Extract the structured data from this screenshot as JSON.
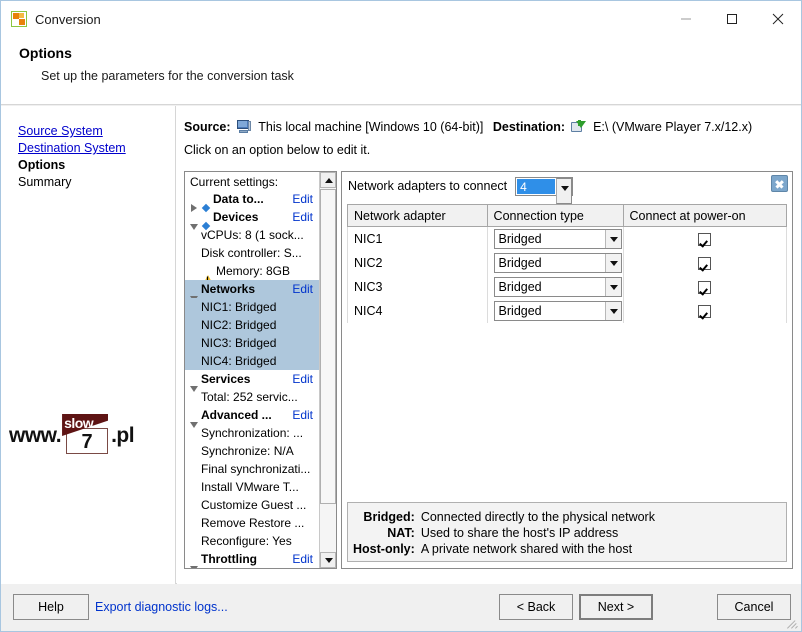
{
  "window": {
    "title": "Conversion",
    "icon": "conversion-app-icon",
    "controls": {
      "minimize": "minimize-icon",
      "maximize": "maximize-icon",
      "close": "close-icon"
    }
  },
  "page_header": {
    "heading": "Options",
    "subheading": "Set up the parameters for the conversion task"
  },
  "left_nav": {
    "items": [
      {
        "label": "Source System",
        "state": "link"
      },
      {
        "label": "Destination System",
        "state": "link"
      },
      {
        "label": "Options",
        "state": "current"
      },
      {
        "label": "Summary",
        "state": "plain"
      }
    ]
  },
  "watermark": {
    "prefix": "www.",
    "banner": "slow",
    "number": "7",
    "suffix": ".pl"
  },
  "source_dest": {
    "source_label": "Source:",
    "source_icon": "local-machine-icon",
    "source_value": "This local machine [Windows 10 (64-bit)]",
    "destination_label": "Destination:",
    "destination_icon": "destination-disk-icon",
    "destination_value": "E:\\ (VMware Player 7.x/12.x)",
    "hint": "Click on an option below to edit it."
  },
  "settings_tree": {
    "caption": "Current settings:",
    "edit_label": "Edit",
    "rows": [
      {
        "label": "Data to...",
        "marker": "triangle-right",
        "bullet": "diamond",
        "bold": true,
        "edit": true,
        "selected": false,
        "indent": 0
      },
      {
        "label": "Devices",
        "marker": "triangle-down",
        "bullet": "diamond",
        "bold": true,
        "edit": true,
        "selected": false,
        "indent": 0
      },
      {
        "label": "vCPUs: 8 (1 sock...",
        "marker": "none",
        "bullet": "none",
        "bold": false,
        "edit": false,
        "selected": false,
        "indent": 1
      },
      {
        "label": "Disk controller: S...",
        "marker": "none",
        "bullet": "none",
        "bold": false,
        "edit": false,
        "selected": false,
        "indent": 1
      },
      {
        "label": "Memory: 8GB",
        "marker": "none",
        "bullet": "warning",
        "bold": false,
        "edit": false,
        "selected": false,
        "indent": 1
      },
      {
        "label": "Networks",
        "marker": "triangle-down",
        "bullet": "none",
        "bold": true,
        "edit": true,
        "selected": true,
        "indent": 0
      },
      {
        "label": "NIC1: Bridged",
        "marker": "none",
        "bullet": "none",
        "bold": false,
        "edit": false,
        "selected": true,
        "indent": 1
      },
      {
        "label": "NIC2: Bridged",
        "marker": "none",
        "bullet": "none",
        "bold": false,
        "edit": false,
        "selected": true,
        "indent": 1
      },
      {
        "label": "NIC3: Bridged",
        "marker": "none",
        "bullet": "none",
        "bold": false,
        "edit": false,
        "selected": true,
        "indent": 1
      },
      {
        "label": "NIC4: Bridged",
        "marker": "none",
        "bullet": "none",
        "bold": false,
        "edit": false,
        "selected": true,
        "indent": 1
      },
      {
        "label": "Services",
        "marker": "triangle-down",
        "bullet": "none",
        "bold": true,
        "edit": true,
        "selected": false,
        "indent": 0
      },
      {
        "label": "Total: 252 servic...",
        "marker": "none",
        "bullet": "none",
        "bold": false,
        "edit": false,
        "selected": false,
        "indent": 1
      },
      {
        "label": "Advanced ...",
        "marker": "triangle-down",
        "bullet": "none",
        "bold": true,
        "edit": true,
        "selected": false,
        "indent": 0
      },
      {
        "label": "Synchronization: ...",
        "marker": "none",
        "bullet": "none",
        "bold": false,
        "edit": false,
        "selected": false,
        "indent": 1
      },
      {
        "label": "Synchronize: N/A",
        "marker": "none",
        "bullet": "none",
        "bold": false,
        "edit": false,
        "selected": false,
        "indent": 1
      },
      {
        "label": "Final synchronizati...",
        "marker": "none",
        "bullet": "none",
        "bold": false,
        "edit": false,
        "selected": false,
        "indent": 1
      },
      {
        "label": "Install VMware T...",
        "marker": "none",
        "bullet": "none",
        "bold": false,
        "edit": false,
        "selected": false,
        "indent": 1
      },
      {
        "label": "Customize Guest ...",
        "marker": "none",
        "bullet": "none",
        "bold": false,
        "edit": false,
        "selected": false,
        "indent": 1
      },
      {
        "label": "Remove Restore ...",
        "marker": "none",
        "bullet": "none",
        "bold": false,
        "edit": false,
        "selected": false,
        "indent": 1
      },
      {
        "label": "Reconfigure: Yes",
        "marker": "none",
        "bullet": "none",
        "bold": false,
        "edit": false,
        "selected": false,
        "indent": 1
      },
      {
        "label": "Throttling",
        "marker": "triangle-down",
        "bullet": "none",
        "bold": true,
        "edit": true,
        "selected": false,
        "indent": 0
      }
    ]
  },
  "net_panel": {
    "adapters_label": "Network adapters to connect",
    "adapters_count": "4",
    "close_icon": "panel-close-icon",
    "columns": [
      "Network adapter",
      "Connection type",
      "Connect at power-on"
    ],
    "rows": [
      {
        "adapter": "NIC1",
        "connection_type": "Bridged",
        "connect_at_power_on": true
      },
      {
        "adapter": "NIC2",
        "connection_type": "Bridged",
        "connect_at_power_on": true
      },
      {
        "adapter": "NIC3",
        "connection_type": "Bridged",
        "connect_at_power_on": true
      },
      {
        "adapter": "NIC4",
        "connection_type": "Bridged",
        "connect_at_power_on": true
      }
    ],
    "legend": [
      {
        "term": "Bridged:",
        "desc": "Connected directly to the physical network"
      },
      {
        "term": "NAT:",
        "desc": "Used to share the host's IP address"
      },
      {
        "term": "Host-only:",
        "desc": "A private network shared with the host"
      }
    ]
  },
  "footer": {
    "help": "Help",
    "export_logs": "Export diagnostic logs...",
    "back": "< Back",
    "next": "Next >",
    "cancel": "Cancel"
  },
  "colors": {
    "link": "#0033cc",
    "selection": "#aec7dc",
    "combo_highlight": "#2f8fe8",
    "warning": "#f2c230",
    "diamond": "#2b7fd4"
  }
}
